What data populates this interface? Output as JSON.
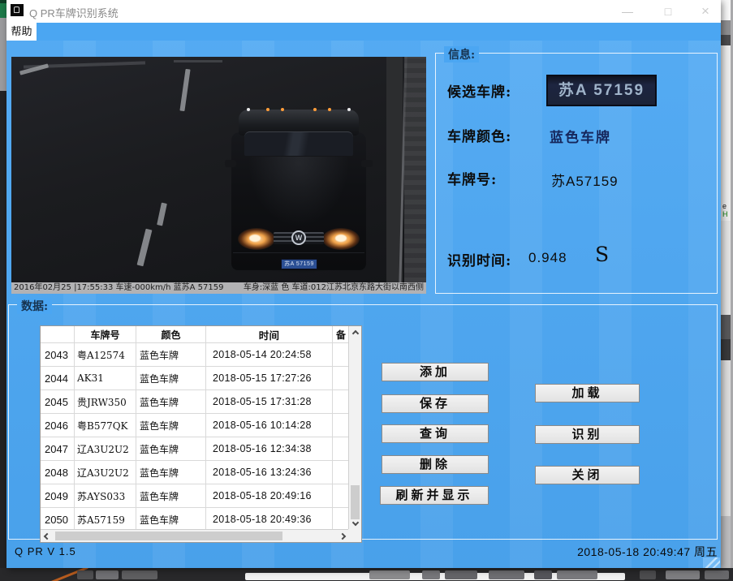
{
  "window": {
    "title": "Q PR车牌识别系统",
    "controls": {
      "minimize": "—",
      "maximize": "□",
      "close": "×"
    },
    "menu": [
      {
        "label": "帮助"
      }
    ]
  },
  "camera": {
    "overlay_left": "2016年02月25 |17:55:33 车速-000km/h 蓝苏A 57159",
    "overlay_right": "车身:深蓝 色 车道:012江苏北京东路大街以南西侧",
    "car_plate": "苏A 57159"
  },
  "info": {
    "title": "信息:",
    "candidate_label": "候选车牌:",
    "candidate_plate_text": "苏A 57159",
    "color_label": "车牌颜色:",
    "color_value": "蓝色车牌",
    "plate_label": "车牌号:",
    "plate_value": "苏A57159",
    "time_label": "识别时间:",
    "time_value": "0.948",
    "time_unit": "S"
  },
  "data_panel": {
    "title": "数据:",
    "headers": [
      "车牌号",
      "颜色",
      "时间",
      "备"
    ],
    "rows": [
      {
        "id": "2043",
        "plate": "粤A12574",
        "color": "蓝色车牌",
        "time": "2018-05-14 20:24:58",
        "note": ""
      },
      {
        "id": "2044",
        "plate": "AK31",
        "color": "蓝色车牌",
        "time": "2018-05-15 17:27:26",
        "note": ""
      },
      {
        "id": "2045",
        "plate": "贵JRW350",
        "color": "蓝色车牌",
        "time": "2018-05-15 17:31:28",
        "note": ""
      },
      {
        "id": "2046",
        "plate": "粤B577QK",
        "color": "蓝色车牌",
        "time": "2018-05-16 10:14:28",
        "note": ""
      },
      {
        "id": "2047",
        "plate": "辽A3U2U2",
        "color": "蓝色车牌",
        "time": "2018-05-16 12:34:38",
        "note": ""
      },
      {
        "id": "2048",
        "plate": "辽A3U2U2",
        "color": "蓝色车牌",
        "time": "2018-05-16 13:24:36",
        "note": ""
      },
      {
        "id": "2049",
        "plate": "苏AYS033",
        "color": "蓝色车牌",
        "time": "2018-05-18 20:49:16",
        "note": ""
      },
      {
        "id": "2050",
        "plate": "苏A57159",
        "color": "蓝色车牌",
        "time": "2018-05-18 20:49:36",
        "note": ""
      }
    ],
    "buttons_left": [
      "添加",
      "保存",
      "查询",
      "删除",
      "刷新并显示"
    ],
    "buttons_right": [
      "加载",
      "识别",
      "关闭"
    ]
  },
  "status": {
    "version": "Q PR V 1.5",
    "datetime": "2018-05-18 20:49:47 周五"
  },
  "icons": {
    "vw_logo": "W"
  },
  "background": {
    "edge_text_1": "e",
    "edge_text_2": "H"
  }
}
